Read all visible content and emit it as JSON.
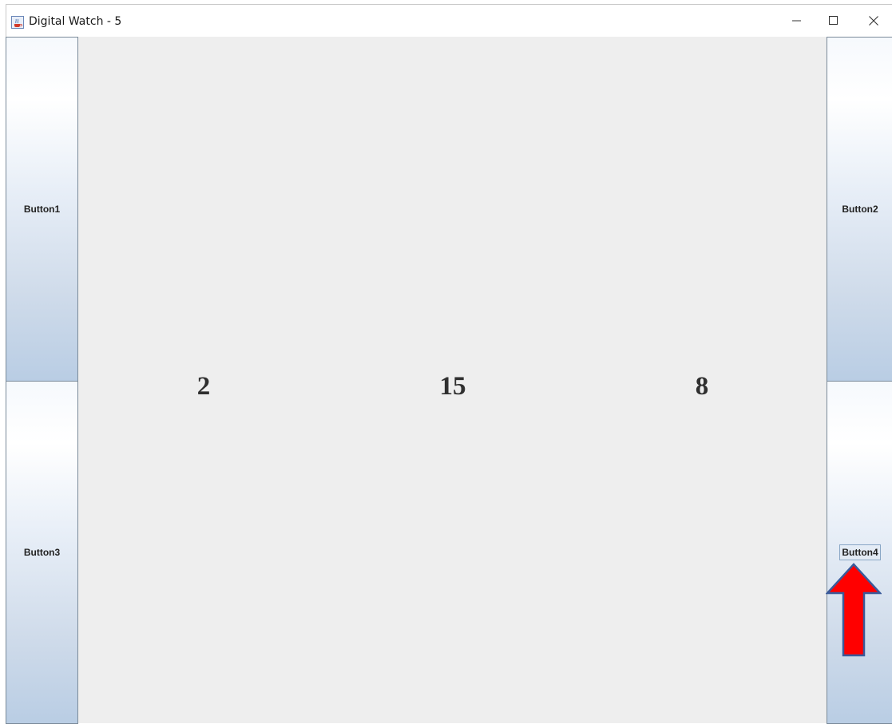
{
  "window": {
    "title": "Digital Watch - 5",
    "icon": "java-cup-icon"
  },
  "title_controls": {
    "minimize_icon": "minimize-icon",
    "maximize_icon": "maximize-icon",
    "close_icon": "close-icon"
  },
  "buttons": {
    "button1": "Button1",
    "button2": "Button2",
    "button3": "Button3",
    "button4": "Button4"
  },
  "display": {
    "hours": "2",
    "minutes": "15",
    "seconds": "8"
  },
  "annotation": {
    "arrow_icon": "up-arrow-icon",
    "arrow_color": "#ff0000",
    "arrow_outline": "#3a5a9a",
    "points_to": "Button4"
  },
  "colors": {
    "background": "#eeeeee",
    "digit": "#2f2f2f"
  }
}
